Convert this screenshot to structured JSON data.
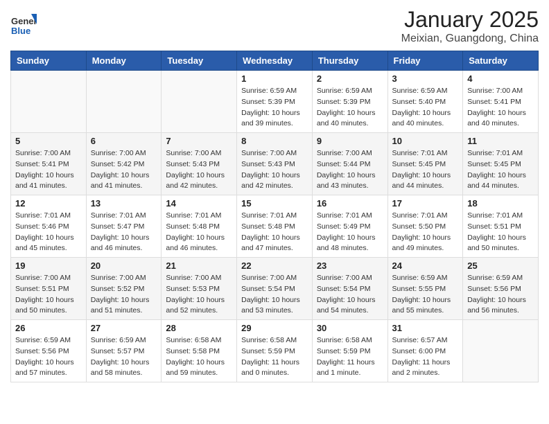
{
  "header": {
    "logo_text_general": "General",
    "logo_text_blue": "Blue",
    "title": "January 2025",
    "subtitle": "Meixian, Guangdong, China"
  },
  "calendar": {
    "days_of_week": [
      "Sunday",
      "Monday",
      "Tuesday",
      "Wednesday",
      "Thursday",
      "Friday",
      "Saturday"
    ],
    "weeks": [
      [
        {
          "day": "",
          "info": ""
        },
        {
          "day": "",
          "info": ""
        },
        {
          "day": "",
          "info": ""
        },
        {
          "day": "1",
          "info": "Sunrise: 6:59 AM\nSunset: 5:39 PM\nDaylight: 10 hours\nand 39 minutes."
        },
        {
          "day": "2",
          "info": "Sunrise: 6:59 AM\nSunset: 5:39 PM\nDaylight: 10 hours\nand 40 minutes."
        },
        {
          "day": "3",
          "info": "Sunrise: 6:59 AM\nSunset: 5:40 PM\nDaylight: 10 hours\nand 40 minutes."
        },
        {
          "day": "4",
          "info": "Sunrise: 7:00 AM\nSunset: 5:41 PM\nDaylight: 10 hours\nand 40 minutes."
        }
      ],
      [
        {
          "day": "5",
          "info": "Sunrise: 7:00 AM\nSunset: 5:41 PM\nDaylight: 10 hours\nand 41 minutes."
        },
        {
          "day": "6",
          "info": "Sunrise: 7:00 AM\nSunset: 5:42 PM\nDaylight: 10 hours\nand 41 minutes."
        },
        {
          "day": "7",
          "info": "Sunrise: 7:00 AM\nSunset: 5:43 PM\nDaylight: 10 hours\nand 42 minutes."
        },
        {
          "day": "8",
          "info": "Sunrise: 7:00 AM\nSunset: 5:43 PM\nDaylight: 10 hours\nand 42 minutes."
        },
        {
          "day": "9",
          "info": "Sunrise: 7:00 AM\nSunset: 5:44 PM\nDaylight: 10 hours\nand 43 minutes."
        },
        {
          "day": "10",
          "info": "Sunrise: 7:01 AM\nSunset: 5:45 PM\nDaylight: 10 hours\nand 44 minutes."
        },
        {
          "day": "11",
          "info": "Sunrise: 7:01 AM\nSunset: 5:45 PM\nDaylight: 10 hours\nand 44 minutes."
        }
      ],
      [
        {
          "day": "12",
          "info": "Sunrise: 7:01 AM\nSunset: 5:46 PM\nDaylight: 10 hours\nand 45 minutes."
        },
        {
          "day": "13",
          "info": "Sunrise: 7:01 AM\nSunset: 5:47 PM\nDaylight: 10 hours\nand 46 minutes."
        },
        {
          "day": "14",
          "info": "Sunrise: 7:01 AM\nSunset: 5:48 PM\nDaylight: 10 hours\nand 46 minutes."
        },
        {
          "day": "15",
          "info": "Sunrise: 7:01 AM\nSunset: 5:48 PM\nDaylight: 10 hours\nand 47 minutes."
        },
        {
          "day": "16",
          "info": "Sunrise: 7:01 AM\nSunset: 5:49 PM\nDaylight: 10 hours\nand 48 minutes."
        },
        {
          "day": "17",
          "info": "Sunrise: 7:01 AM\nSunset: 5:50 PM\nDaylight: 10 hours\nand 49 minutes."
        },
        {
          "day": "18",
          "info": "Sunrise: 7:01 AM\nSunset: 5:51 PM\nDaylight: 10 hours\nand 50 minutes."
        }
      ],
      [
        {
          "day": "19",
          "info": "Sunrise: 7:00 AM\nSunset: 5:51 PM\nDaylight: 10 hours\nand 50 minutes."
        },
        {
          "day": "20",
          "info": "Sunrise: 7:00 AM\nSunset: 5:52 PM\nDaylight: 10 hours\nand 51 minutes."
        },
        {
          "day": "21",
          "info": "Sunrise: 7:00 AM\nSunset: 5:53 PM\nDaylight: 10 hours\nand 52 minutes."
        },
        {
          "day": "22",
          "info": "Sunrise: 7:00 AM\nSunset: 5:54 PM\nDaylight: 10 hours\nand 53 minutes."
        },
        {
          "day": "23",
          "info": "Sunrise: 7:00 AM\nSunset: 5:54 PM\nDaylight: 10 hours\nand 54 minutes."
        },
        {
          "day": "24",
          "info": "Sunrise: 6:59 AM\nSunset: 5:55 PM\nDaylight: 10 hours\nand 55 minutes."
        },
        {
          "day": "25",
          "info": "Sunrise: 6:59 AM\nSunset: 5:56 PM\nDaylight: 10 hours\nand 56 minutes."
        }
      ],
      [
        {
          "day": "26",
          "info": "Sunrise: 6:59 AM\nSunset: 5:56 PM\nDaylight: 10 hours\nand 57 minutes."
        },
        {
          "day": "27",
          "info": "Sunrise: 6:59 AM\nSunset: 5:57 PM\nDaylight: 10 hours\nand 58 minutes."
        },
        {
          "day": "28",
          "info": "Sunrise: 6:58 AM\nSunset: 5:58 PM\nDaylight: 10 hours\nand 59 minutes."
        },
        {
          "day": "29",
          "info": "Sunrise: 6:58 AM\nSunset: 5:59 PM\nDaylight: 11 hours\nand 0 minutes."
        },
        {
          "day": "30",
          "info": "Sunrise: 6:58 AM\nSunset: 5:59 PM\nDaylight: 11 hours\nand 1 minute."
        },
        {
          "day": "31",
          "info": "Sunrise: 6:57 AM\nSunset: 6:00 PM\nDaylight: 11 hours\nand 2 minutes."
        },
        {
          "day": "",
          "info": ""
        }
      ]
    ]
  }
}
